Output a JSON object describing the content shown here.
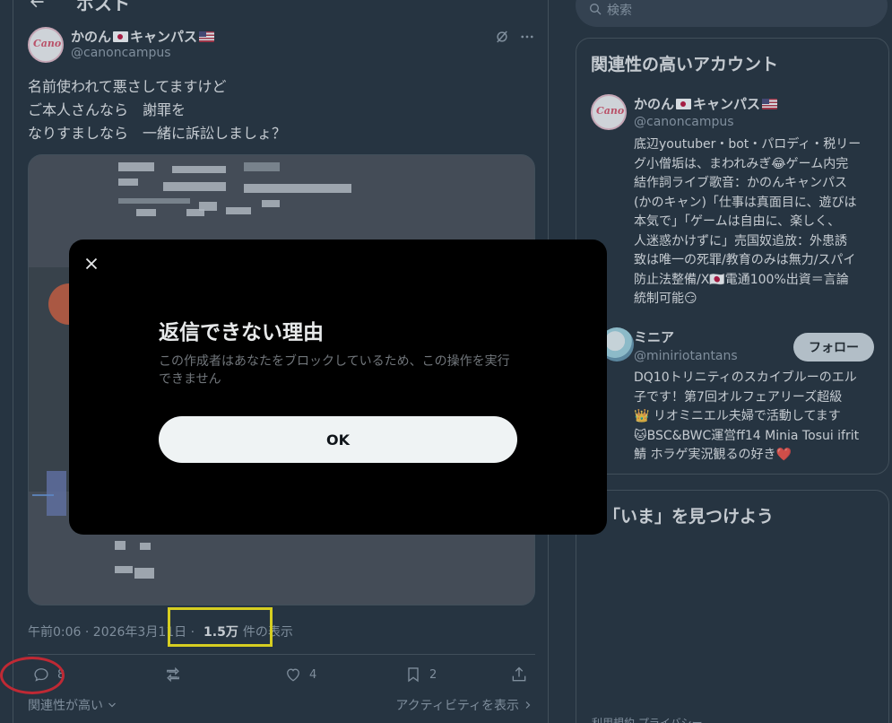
{
  "header": {
    "title": "ポスト"
  },
  "post": {
    "author": {
      "name": "かのん",
      "name_suffix": "キャンパス",
      "handle": "@canoncampus",
      "avatar_text": "Canon"
    },
    "text_lines": [
      "名前使われて悪さしてますけど",
      "ご本人さんなら　謝罪を",
      "なりすましなら　一緒に訴訟しましょ？"
    ],
    "meta": {
      "time": "午前0:06 · 2026年3月11日 ·",
      "views_count": "1.5万",
      "views_label": "件の表示"
    },
    "actions": {
      "reply_count": "8",
      "retweet_count": "",
      "like_count": "4",
      "bookmark_count": "2"
    },
    "sort_label": "関連性が高い",
    "activity_label": "アクティビティを表示"
  },
  "search": {
    "placeholder": "検索"
  },
  "related": {
    "title": "関連性の高いアカウント",
    "accounts": [
      {
        "name": "かのん",
        "name_suffix": "キャンパス",
        "handle": "@canoncampus",
        "bio_lines": [
          "底辺youtuber・bot・パロディ・税リー",
          "グ小僧垢は、まわれみぎ😂ゲーム内完",
          "結作詞ライブ歌音：かのんキャンパス",
          "(かのキャン)「仕事は真面目に、遊びは",
          "本気で」「ゲームは自由に、楽しく、",
          "人迷惑かけずに」売国奴追放：外患誘",
          "致は唯一の死罪/教育のみは無力/スパイ",
          "防止法整備/X🇯🇵電通100%出資＝言論",
          "統制可能😏"
        ]
      },
      {
        "name": "ミニア",
        "handle": "@miniriotantans",
        "follow_label": "フォロー",
        "bio_lines": [
          "DQ10トリニティのスカイブルーのエル",
          "子です！第7回オルフェアリーズ超級",
          "👑 リオミニエル夫婦で活動してます",
          "🐱BSC&BWC運営ff14 Minia Tosui ifrit",
          "鯖 ホラゲ実況観るの好き❤️"
        ]
      }
    ]
  },
  "discover": {
    "title": "「いま」を見つけよう"
  },
  "footer": {
    "text": "利用規約  プライバシー"
  },
  "modal": {
    "title": "返信できない理由",
    "body": "この作成者はあなたをブロックしているため、この操作を実行できません",
    "ok_label": "OK"
  },
  "colors": {
    "background": "#15202b",
    "modal_bg": "#000000",
    "highlight_yellow": "#ffee00",
    "highlight_red": "#e0121a"
  }
}
